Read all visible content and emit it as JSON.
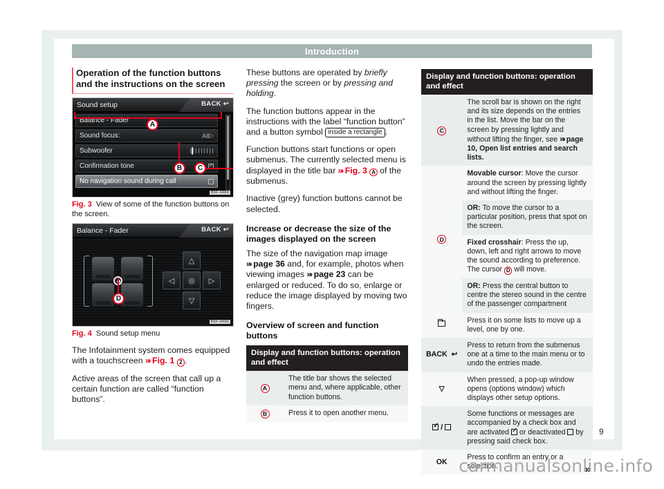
{
  "header": {
    "running_title": "Introduction"
  },
  "page_number": "9",
  "watermark": "carmanualsonline.info",
  "left_column": {
    "section_title": "Operation of the function buttons and the instructions on the screen",
    "fig3": {
      "screen": {
        "title": "Sound setup",
        "back_label": "BACK",
        "rows": [
          {
            "label": "Balance - Fader",
            "right": "",
            "selected": false
          },
          {
            "label": "Sound focus:",
            "right": "All",
            "selected": false
          },
          {
            "label": "Subwoofer",
            "right": "slider",
            "selected": false
          },
          {
            "label": "Confirmation tone",
            "right": "checkbox-on",
            "selected": false
          },
          {
            "label": "No navigation sound during call",
            "right": "checkbox-off",
            "selected": true
          }
        ],
        "image_code": "B5F-0489",
        "callouts": [
          "A",
          "B",
          "C"
        ]
      },
      "caption_number": "Fig. 3",
      "caption_text": "View of some of the function buttons on the screen."
    },
    "fig4": {
      "screen": {
        "title": "Balance - Fader",
        "back_label": "BACK",
        "image_code": "B5F-0490",
        "callouts": [
          "D"
        ]
      },
      "caption_number": "Fig. 4",
      "caption_text": "Sound setup menu"
    },
    "para_1_a": "The Infotainment system comes equipped with a touchscreen ",
    "para_1_ref": "Fig. 1",
    "para_1_callout": "2",
    "para_2": "Active areas of the screen that call up a certain function are called “function buttons”."
  },
  "mid_column": {
    "para_1_part1": "These buttons are operated by ",
    "para_1_it1": "briefly pressing",
    "para_1_part2": " the screen or by ",
    "para_1_it2": "pressing and holding",
    "para_1_part3": ".",
    "para_2_part1": "The function buttons appear in the instructions with the label “function button” and a button symbol ",
    "para_2_rect": "inside a rectangle",
    "para_2_part2": ".",
    "para_3_part1": "Function buttons start functions or open submenus. The currently selected menu is displayed in the title bar ",
    "para_3_ref": "Fig. 3",
    "para_3_callout": "A",
    "para_3_part2": " of the submenus.",
    "para_4": "Inactive (grey) function buttons cannot be selected.",
    "heading_2": "Increase or decrease the size of the images displayed on the screen",
    "para_5_part1": "The size of the navigation map image ",
    "para_5_ref1": "page 36",
    "para_5_part2": " and, for example, photos when viewing images ",
    "para_5_ref2": "page 23",
    "para_5_part3": " can be enlarged or reduced. To do so, enlarge or reduce the image displayed by moving two fingers.",
    "heading_3": "Overview of screen and function buttons",
    "table": {
      "header": "Display and function buttons: operation and effect",
      "rows": [
        {
          "symbol": "A",
          "symbol_type": "circle",
          "text": "The title bar shows the selected menu and, where applicable, other function buttons."
        },
        {
          "symbol": "B",
          "symbol_type": "circle",
          "text": "Press it to open another menu."
        }
      ]
    }
  },
  "right_column": {
    "table": {
      "header": "Display and function buttons: operation and effect",
      "rows": [
        {
          "symbol": "C",
          "symbol_type": "circle",
          "blocks": [
            {
              "lead": "",
              "text": "The scroll bar is shown on the right and its size depends on the entries in the list. Move the bar on the screen by pressing lightly and without lifting the finger, see ",
              "ref": "page 10,",
              "tail": " Open list entries and search lists."
            }
          ]
        },
        {
          "symbol": "D",
          "symbol_type": "circle",
          "blocks": [
            {
              "lead": "Movable cursor",
              "text": ": Move the cursor around the screen by pressing lightly and without lifting the finger."
            },
            {
              "lead": "OR:",
              "text": " To move the cursor to a particular position, press that spot on the screen."
            },
            {
              "lead": "Fixed crosshair",
              "text": ": Press the up, down, left and right arrows to move the sound according to preference. The cursor ",
              "inline_callout": "D",
              "tail": " will move."
            },
            {
              "lead": "OR:",
              "text": " Press the central button to centre the stereo sound in the centre of the passenger compartment"
            }
          ]
        },
        {
          "symbol": "folder",
          "symbol_type": "icon",
          "text": "Press it on some lists to move up a level, one by one."
        },
        {
          "symbol": "BACK",
          "symbol_type": "back",
          "text": "Press to return from the submenus one at a time to the main menu or to undo the entries made."
        },
        {
          "symbol": "▽",
          "symbol_type": "glyph",
          "text": "When pressed, a pop-up window opens (options window) which displays other setup options."
        },
        {
          "symbol": "checkbox",
          "symbol_type": "checkbox",
          "text": "Some functions or messages are accompanied by a check box and are activated  or deactivated  by pressing said check box."
        },
        {
          "symbol": "OK",
          "symbol_type": "text",
          "text": "Press to confirm an entry or a selection."
        }
      ]
    },
    "continue_marker": "»"
  }
}
